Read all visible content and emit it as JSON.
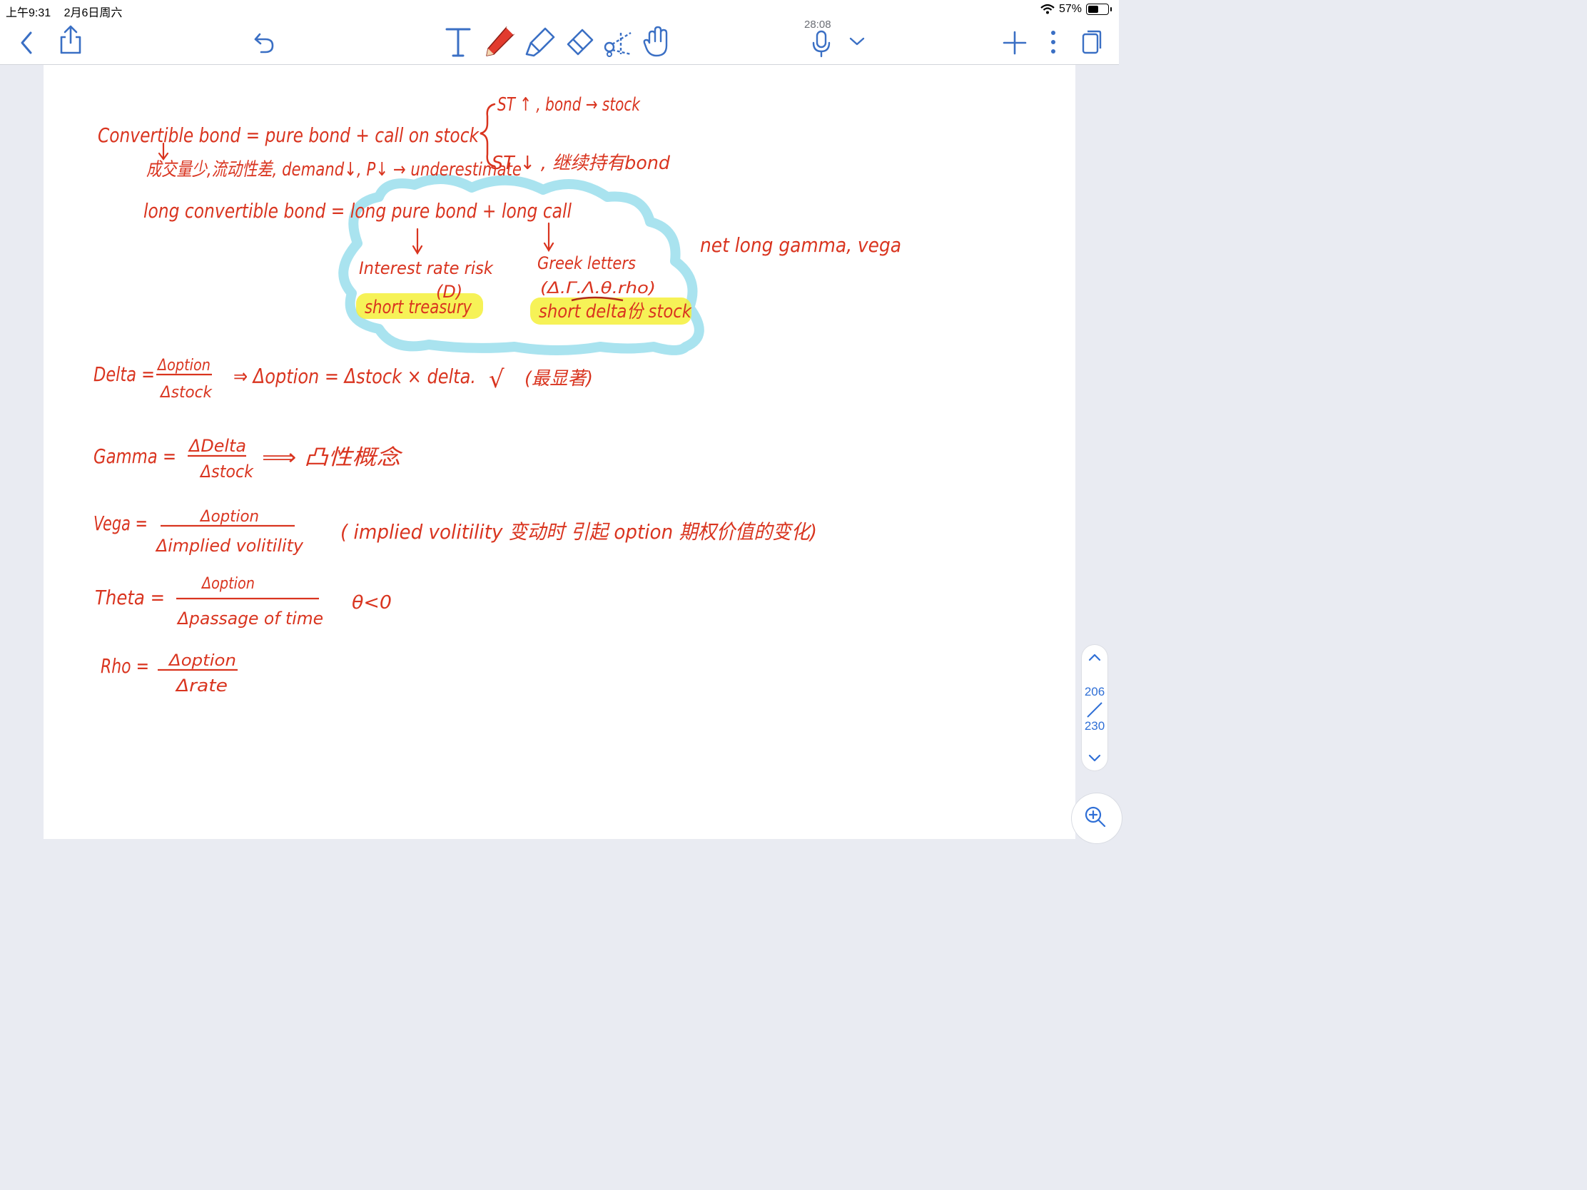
{
  "status": {
    "time": "上午9:31",
    "date": "2月6日周六",
    "battery": "57%",
    "battery_level": 0.57
  },
  "toolbar": {
    "recording_time": "28:08"
  },
  "pager": {
    "current": "206",
    "total": "230"
  },
  "notes": {
    "line1_left": "Convertible bond = pure bond + call on stock",
    "line1_br_top": "ST ↑ , bond → stock",
    "line2": "成交量少,流动性差, demand↓, P↓ → underestimate",
    "line1_br_bottom": "ST ↓ , 继续持有bond",
    "line3": "long convertible bond = long pure bond + long call",
    "left_sub1": "Interest rate risk",
    "left_sub2": "(D)",
    "left_sub3": "short treasury",
    "right_sub1": "Greek letters",
    "right_sub2": "(Δ.Γ.Λ.θ.rho)",
    "right_sub3": "short delta份 stock",
    "side_note": "net long gamma, vega",
    "delta_label": "Delta =",
    "delta_num": "Δoption",
    "delta_den": "Δstock",
    "delta_rest": "⇒ Δoption = Δstock × delta.",
    "delta_check": "√",
    "delta_note": "(最显著)",
    "gamma_label": "Gamma =",
    "gamma_num": "ΔDelta",
    "gamma_den": "Δstock",
    "gamma_rest": "⟹ 凸性概念",
    "vega_label": "Vega =",
    "vega_num": "Δoption",
    "vega_den": "Δimplied volitility",
    "vega_note": "( implied volitility 变动时 引起 option 期权价值的变化)",
    "theta_label": "Theta =",
    "theta_num": "Δoption",
    "theta_den": "Δpassage of time",
    "theta_note": "θ<0",
    "rho_label": "Rho =",
    "rho_num": "Δoption",
    "rho_den": "Δrate"
  },
  "colors": {
    "ink": "#d9341f",
    "highlight": "#f4f03a",
    "cloud": "#a9e3ef",
    "accent": "#2f6fd6",
    "icon": "#3a6fc4"
  }
}
